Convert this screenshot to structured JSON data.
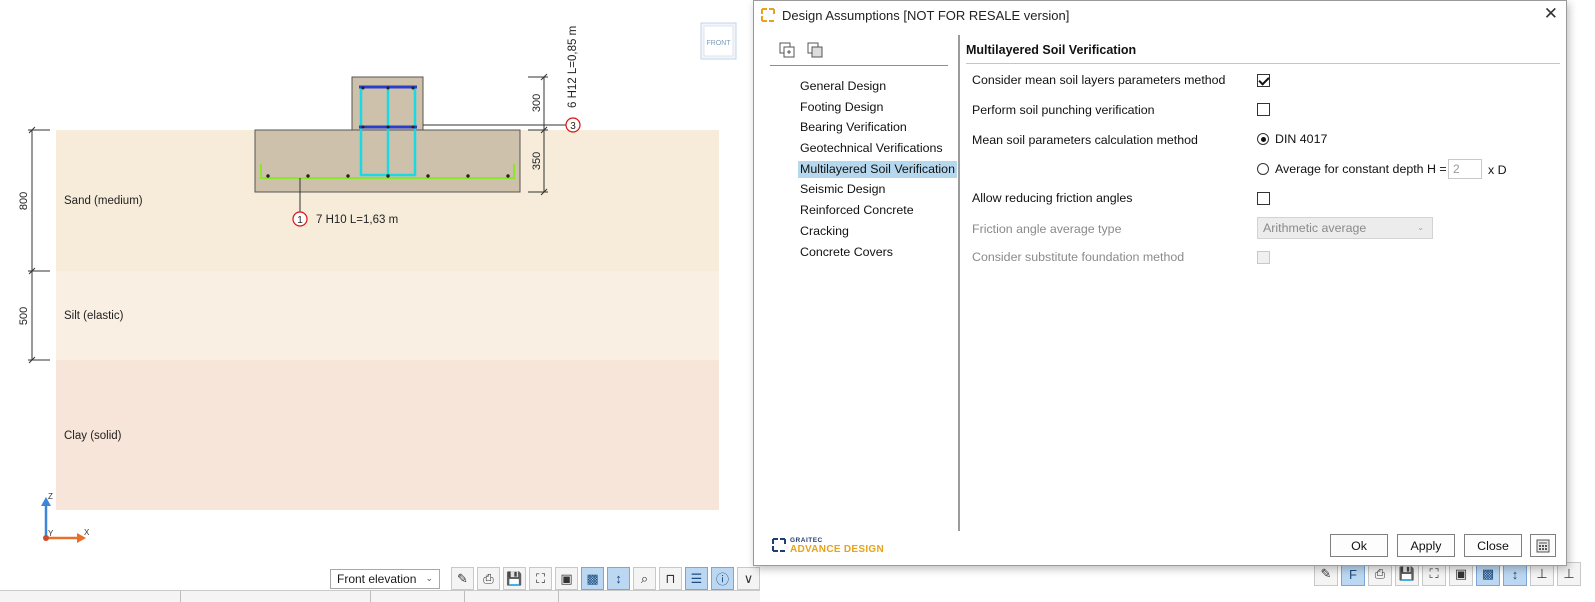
{
  "viewport": {
    "view_tag": "FRONT",
    "layers": [
      {
        "label": "Sand (medium)",
        "depth": "800",
        "color": "#f6ecd9"
      },
      {
        "label": "Silt (elastic)",
        "depth": "500",
        "color": "#faefe3"
      },
      {
        "label": "Clay (solid)",
        "color": "#f7e5da"
      }
    ],
    "dims": {
      "column": "300",
      "footing": "350"
    },
    "rebar_callouts": [
      {
        "mark": "1",
        "text": "7 H10 L=1,63 m"
      },
      {
        "mark": "3",
        "text": "6 H12 L=0,85 m"
      }
    ],
    "axes": {
      "z": "Z",
      "x": "X",
      "y": "Y"
    },
    "view_select": "Front elevation",
    "toolbar_icons": [
      "measure-icon",
      "print-icon",
      "save-image-icon",
      "fit-view-icon",
      "3d-box-icon",
      "shaded-view-icon",
      "dimension-icon",
      "zoom-window-icon",
      "section-icon",
      "list-icon",
      "info-icon",
      "expand-icon"
    ]
  },
  "dialog": {
    "title": "Design Assumptions [NOT FOR RESALE version]",
    "nav_items": [
      "General Design",
      "Footing Design",
      "Bearing Verification",
      "Geotechnical Verifications",
      "Multilayered Soil Verification",
      "Seismic Design",
      "Reinforced Concrete",
      "Cracking",
      "Concrete Covers"
    ],
    "selected_nav": "Multilayered Soil Verification",
    "panel": {
      "title": "Multilayered Soil Verification",
      "consider_mean": {
        "label": "Consider mean soil layers parameters method",
        "checked": true
      },
      "punching": {
        "label": "Perform soil punching verification",
        "checked": false
      },
      "calc_method": {
        "label": "Mean soil parameters calculation method",
        "option1": "DIN 4017",
        "option2": "Average for constant depth H =",
        "depth_value": "2",
        "depth_unit": "x D",
        "selected": "DIN 4017"
      },
      "reduce_friction": {
        "label": "Allow reducing friction angles",
        "checked": false
      },
      "friction_type": {
        "label": "Friction angle average type",
        "value": "Arithmetic average"
      },
      "substitute": {
        "label": "Consider substitute foundation method",
        "checked": false
      }
    },
    "logo": {
      "small": "GRAITEC",
      "big": "ADVANCE DESIGN"
    },
    "buttons": {
      "ok": "Ok",
      "apply": "Apply",
      "close": "Close"
    }
  }
}
